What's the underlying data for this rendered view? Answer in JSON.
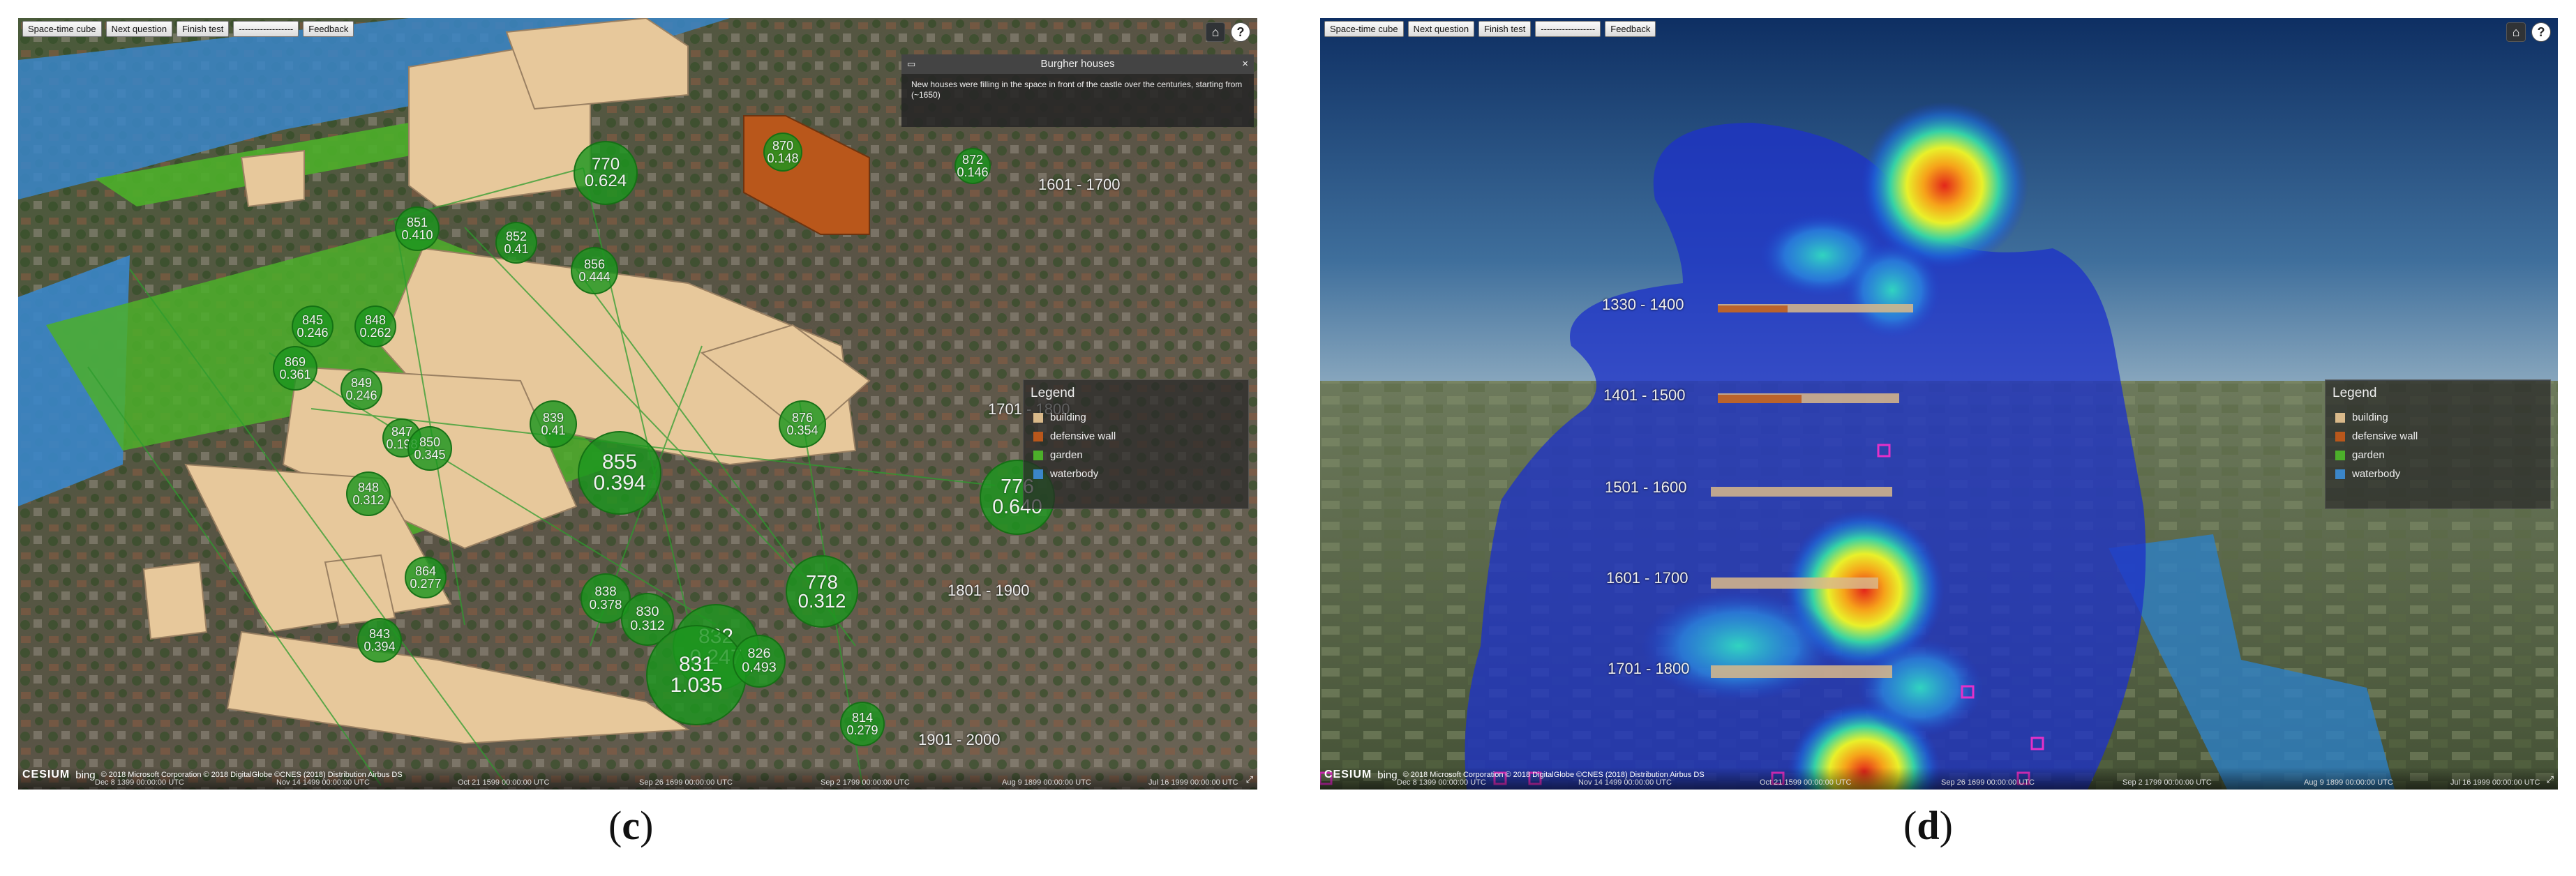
{
  "toolbar": {
    "buttons": [
      "Space-time cube",
      "Next question",
      "Finish test",
      "------------------",
      "Feedback"
    ]
  },
  "icons": {
    "home": "home-icon",
    "help": "help-icon",
    "close": "close-icon",
    "fullscreen": "fullscreen-icon"
  },
  "panel_c": {
    "infobox": {
      "title": "Burgher houses",
      "text": "New houses were filling in the space in front of the castle over the centuries, starting from (~1650)"
    },
    "legend": {
      "title": "Legend",
      "items": [
        {
          "label": "building",
          "color": "#d9b98a"
        },
        {
          "label": "defensive wall",
          "color": "#b9571b"
        },
        {
          "label": "garden",
          "color": "#4caf2a"
        },
        {
          "label": "waterbody",
          "color": "#3b86c8"
        }
      ]
    },
    "time_labels": [
      "1601 - 1700",
      "1701 - 1800",
      "1801 - 1900",
      "1901 - 2000"
    ],
    "timeline": [
      "Dec 8 1399 00:00:00 UTC",
      "Nov 14 1499 00:00:00 UTC",
      "Oct 21 1599 00:00:00 UTC",
      "Sep 26 1699 00:00:00 UTC",
      "Sep 2 1799 00:00:00 UTC",
      "Aug 9 1899 00:00:00 UTC",
      "Jul 16 1999 00:00:00 UTC"
    ],
    "bubbles": [
      {
        "a": "770",
        "b": "0.624"
      },
      {
        "a": "851",
        "b": "0.410"
      },
      {
        "a": "852",
        "b": "0.41"
      },
      {
        "a": "856",
        "b": "0.444"
      },
      {
        "a": "845",
        "b": "0.246"
      },
      {
        "a": "848",
        "b": "0.262"
      },
      {
        "a": "869",
        "b": "0.361"
      },
      {
        "a": "849",
        "b": "0.246"
      },
      {
        "a": "839",
        "b": "0.41"
      },
      {
        "a": "847",
        "b": "0.198"
      },
      {
        "a": "850",
        "b": "0.345"
      },
      {
        "a": "855",
        "b": "0.394"
      },
      {
        "a": "848",
        "b": "0.312"
      },
      {
        "a": "876",
        "b": "0.354"
      },
      {
        "a": "776",
        "b": "0.640"
      },
      {
        "a": "838",
        "b": "0.378"
      },
      {
        "a": "830",
        "b": "0.312"
      },
      {
        "a": "832",
        "b": "0.247"
      },
      {
        "a": "831",
        "b": "1.035"
      },
      {
        "a": "843",
        "b": "0.394"
      },
      {
        "a": "778",
        "b": "0.312"
      },
      {
        "a": "826",
        "b": "0.493"
      },
      {
        "a": "814",
        "b": "0.279"
      },
      {
        "a": "864",
        "b": "0.277"
      },
      {
        "a": "870",
        "b": "0.148"
      },
      {
        "a": "872",
        "b": "0.146"
      }
    ]
  },
  "panel_d": {
    "legend": {
      "title": "Legend",
      "items": [
        {
          "label": "building",
          "color": "#d9b98a"
        },
        {
          "label": "defensive wall",
          "color": "#b9571b"
        },
        {
          "label": "garden",
          "color": "#4caf2a"
        },
        {
          "label": "waterbody",
          "color": "#3b86c8"
        }
      ]
    },
    "time_labels": [
      "1330 - 1400",
      "1401 - 1500",
      "1501 - 1600",
      "1601 - 1700",
      "1701 - 1800"
    ],
    "timeline": [
      "Dec 8 1399 00:00:00 UTC",
      "Nov 14 1499 00:00:00 UTC",
      "Oct 21 1599 00:00:00 UTC",
      "Sep 26 1699 00:00:00 UTC",
      "Sep 2 1799 00:00:00 UTC",
      "Aug 9 1899 00:00:00 UTC",
      "Jul 16 1999 00:00:00 UTC"
    ]
  },
  "attribution": "© 2018 Microsoft Corporation © 2018 DigitalGlobe ©CNES (2018) Distribution Airbus DS",
  "cesium_label": "CESIUM",
  "bing_label": "bing",
  "captions": {
    "c_open": "(",
    "c_letter": "c",
    "c_close": ")",
    "d_open": "(",
    "d_letter": "d",
    "d_close": ")"
  }
}
